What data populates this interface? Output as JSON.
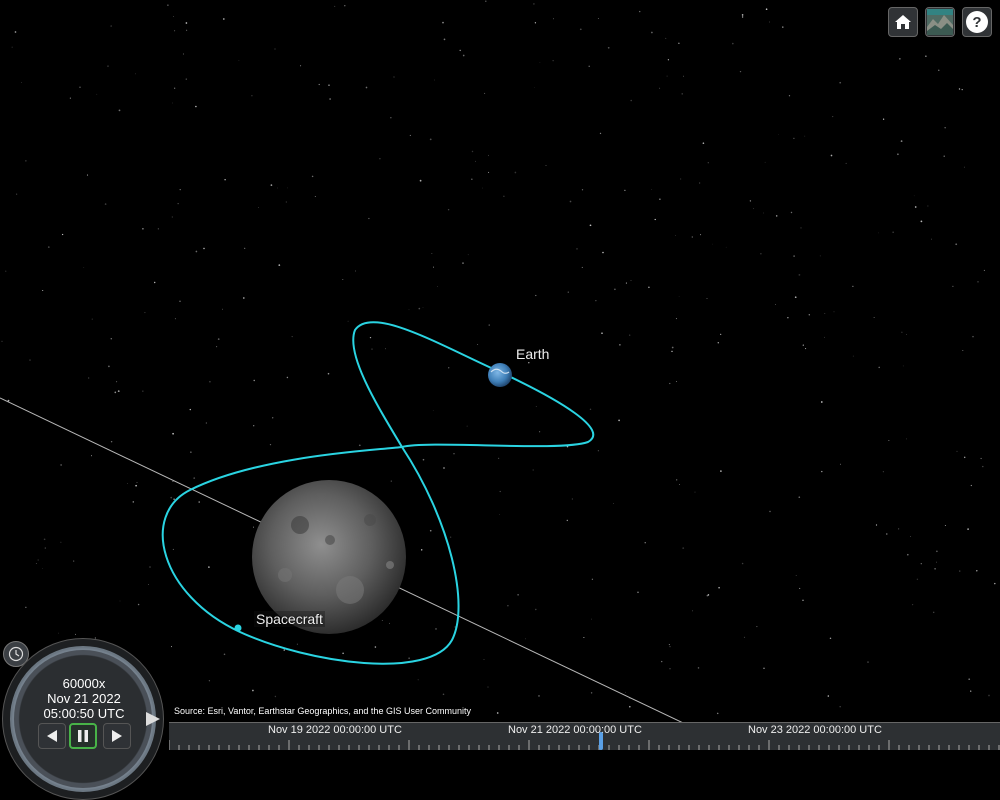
{
  "scene": {
    "earth_label": "Earth",
    "spacecraft_label": "Spacecraft",
    "orbit_color": "#2ad4e2",
    "trail_color": "#d8d8d8"
  },
  "toolbar": {
    "home_icon": "home-icon",
    "base_layer_icon": "base-layer-picker-icon",
    "help_icon": "help-icon",
    "help_glyph": "?"
  },
  "attribution": "Source: Esri, Vantor, Earthstar Geographics, and the GIS User Community",
  "animation": {
    "speed": "60000x",
    "date": "Nov 21 2022",
    "time": "05:00:50 UTC",
    "state": "playing"
  },
  "timeline": {
    "labels": [
      "Nov 19 2022 00:00:00 UTC",
      "Nov 21 2022 00:00:00 UTC",
      "Nov 23 2022 00:00:00 UTC"
    ]
  }
}
